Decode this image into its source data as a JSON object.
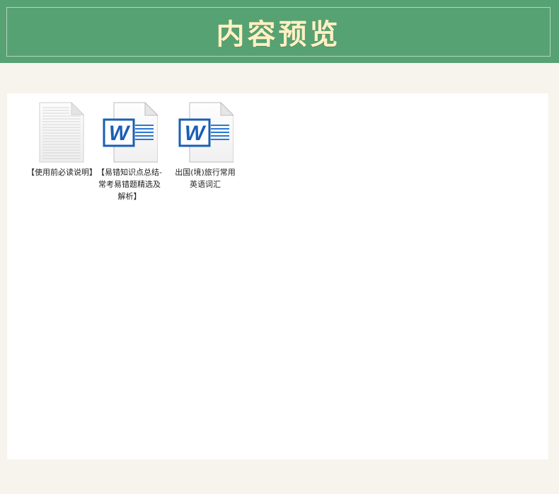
{
  "header": {
    "title": "内容预览"
  },
  "files": [
    {
      "name": "【使用前必读说明】",
      "icon": "text-document-icon"
    },
    {
      "name": "【易错知识点总结-常考易错题精选及解析】",
      "icon": "word-document-icon"
    },
    {
      "name": "出国(境)旅行常用英语词汇",
      "icon": "word-document-icon"
    }
  ],
  "colors": {
    "header_bg": "#56a272",
    "title": "#fff1c4",
    "page_bg": "#f7f4ee",
    "word_blue": "#1a5fb4"
  }
}
